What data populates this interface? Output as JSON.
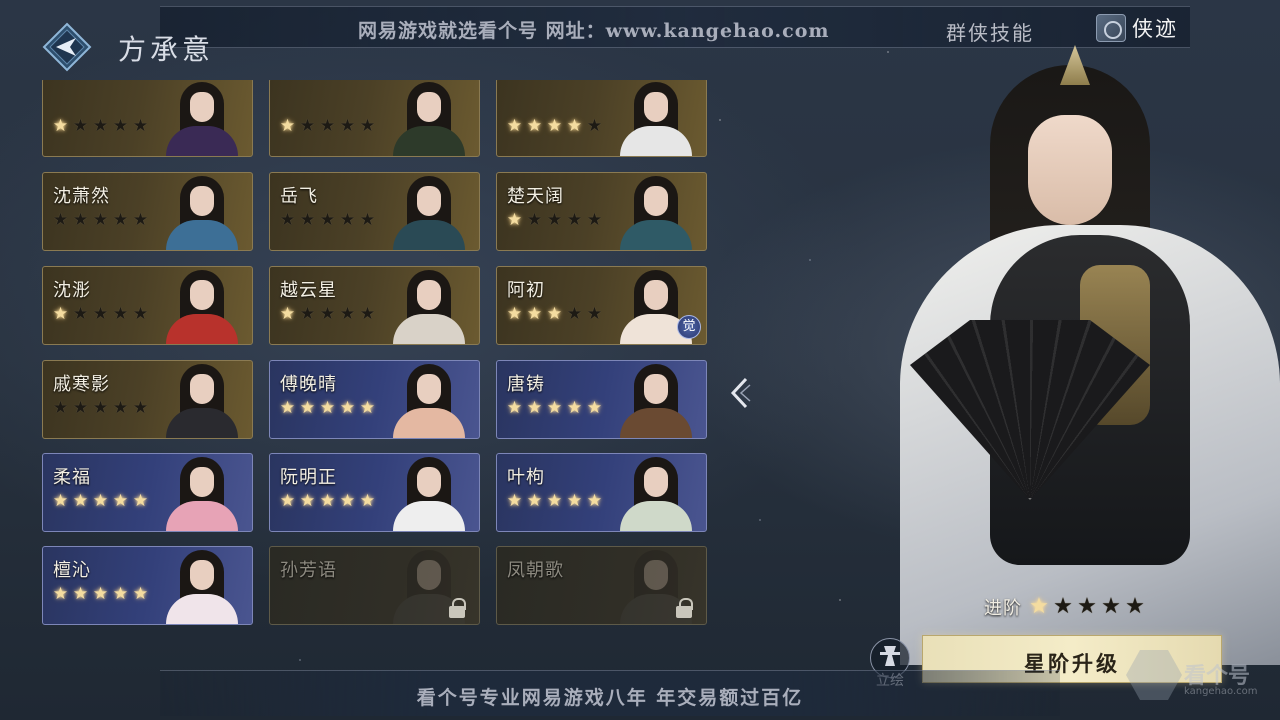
{
  "header": {
    "title": "方承意",
    "watermark": "网易游戏就选看个号  网址：www.kangehao.com",
    "skill_tab": "群侠技能",
    "deed_tab": "侠迹"
  },
  "roster": [
    {
      "name": "",
      "stars": 1,
      "style": "gold",
      "robe": "#3a2a55"
    },
    {
      "name": "",
      "stars": 1,
      "style": "gold",
      "robe": "#2d3a2a"
    },
    {
      "name": "",
      "stars": 4,
      "style": "gold",
      "robe": "#e6e6e6"
    },
    {
      "name": "沈萧然",
      "stars": 0,
      "style": "gold",
      "robe": "#3d6f96"
    },
    {
      "name": "岳飞",
      "stars": 0,
      "style": "gold",
      "robe": "#2a4a55"
    },
    {
      "name": "楚天阔",
      "stars": 1,
      "style": "gold",
      "robe": "#2f5a66"
    },
    {
      "name": "沈浵",
      "stars": 1,
      "style": "gold",
      "robe": "#b8322c"
    },
    {
      "name": "越云星",
      "stars": 1,
      "style": "gold",
      "robe": "#d9d2c8"
    },
    {
      "name": "阿初",
      "stars": 3,
      "style": "gold",
      "robe": "#efe3d8",
      "badge": "觉"
    },
    {
      "name": "戚寒影",
      "stars": 0,
      "style": "gold",
      "robe": "#2a2a2f"
    },
    {
      "name": "傅晚晴",
      "stars": 5,
      "style": "blue",
      "robe": "#e4b8a2"
    },
    {
      "name": "唐铸",
      "stars": 5,
      "style": "blue",
      "robe": "#6a4a32"
    },
    {
      "name": "柔福",
      "stars": 5,
      "style": "blue",
      "robe": "#e7a3b6"
    },
    {
      "name": "阮明正",
      "stars": 5,
      "style": "blue",
      "robe": "#eeeeee"
    },
    {
      "name": "叶枸",
      "stars": 5,
      "style": "blue",
      "robe": "#cfd9c9"
    },
    {
      "name": "檀沁",
      "stars": 5,
      "style": "blue",
      "robe": "#f0e4ea"
    },
    {
      "name": "孙芳语",
      "stars": 0,
      "style": "locked",
      "robe": "#444"
    },
    {
      "name": "凤朝歌",
      "stars": 0,
      "style": "locked",
      "robe": "#444"
    }
  ],
  "hero": {
    "rank_label": "进阶",
    "rank_stars": 1,
    "upgrade_label": "星阶升级",
    "pose_label": "立绘"
  },
  "footer": {
    "banner": "看个号专业网易游戏八年  年交易额过百亿",
    "logo_text": "看个号",
    "logo_sub": "kangehao.com"
  },
  "colors": {
    "star_on": "#f4dca0",
    "star_off": "#1d1a14",
    "accent_gold": "#e9e0b8"
  }
}
